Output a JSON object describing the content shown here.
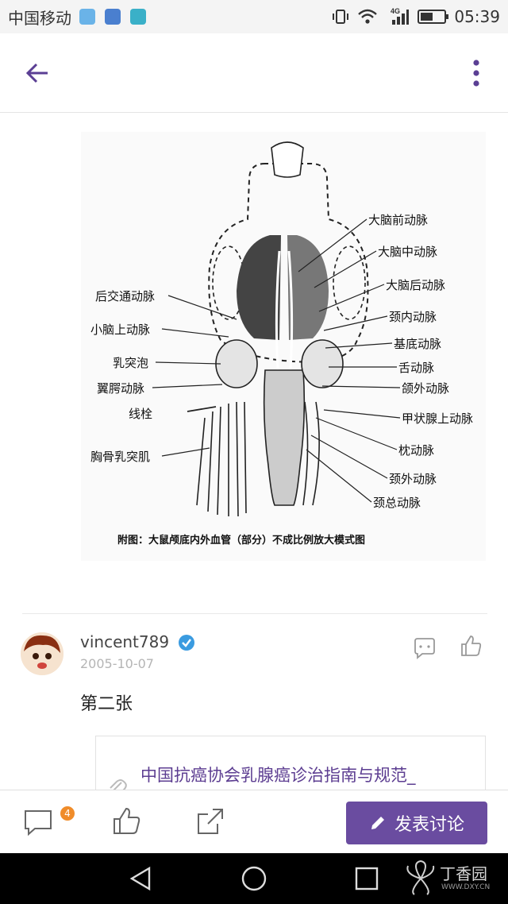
{
  "status_bar": {
    "carrier": "中国移动",
    "network": "4G",
    "time": "05:39",
    "battery_level": 0.55
  },
  "figure": {
    "labels_right": [
      "大脑前动脉",
      "大脑中动脉",
      "大脑后动脉",
      "颈内动脉",
      "基底动脉",
      "舌动脉",
      "颌外动脉",
      "甲状腺上动脉",
      "枕动脉",
      "颈外动脉",
      "颈总动脉"
    ],
    "labels_left": [
      "后交通动脉",
      "小脑上动脉",
      "乳突泡",
      "翼腭动脉",
      "线栓",
      "胸骨乳突肌"
    ],
    "caption": "附图：大鼠颅底内外血管（部分）不成比例放大模式图"
  },
  "comment": {
    "username": "vincent789",
    "date": "2005-10-07",
    "text": "第二张",
    "attachment_title": "中国抗癌协会乳腺癌诊治指南与规范_"
  },
  "toolbar": {
    "comment_count": "4",
    "discuss_label": "发表讨论"
  },
  "watermark": {
    "brand": "丁香园",
    "url": "WWW.DXY.CN"
  },
  "colors": {
    "accent": "#6a4ca0",
    "link": "#5c3d91",
    "badge": "#f08c2a",
    "verified": "#3a9be0"
  }
}
